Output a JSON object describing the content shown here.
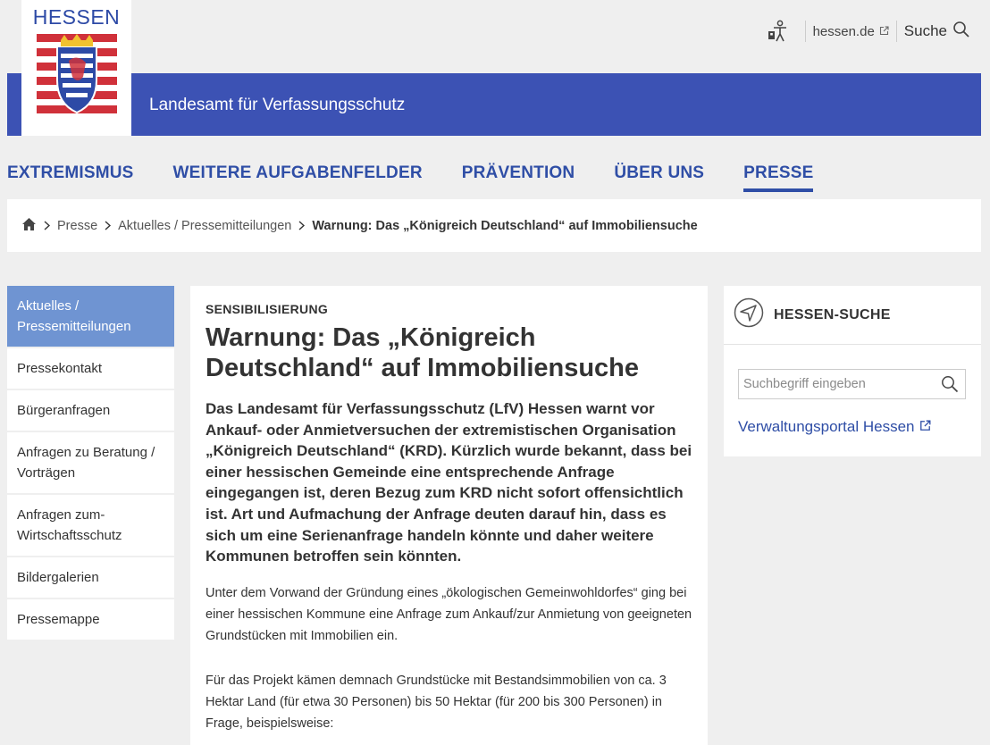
{
  "header": {
    "logo_text": "HESSEN",
    "portal_link": "hessen.de",
    "search_label": "Suche",
    "banner_title": "Landesamt für Verfassungsschutz"
  },
  "main_nav": [
    {
      "label": "EXTREMISMUS"
    },
    {
      "label": "WEITERE AUFGABENFELDER"
    },
    {
      "label": "PRÄVENTION"
    },
    {
      "label": "ÜBER UNS"
    },
    {
      "label": "PRESSE"
    }
  ],
  "breadcrumb": {
    "items": [
      "Presse",
      "Aktuelles / Pressemitteilungen"
    ],
    "current": "Warnung: Das „Königreich Deutschland“ auf Immobiliensuche"
  },
  "sidebar": {
    "items": [
      {
        "label": "Aktuelles / Pressemitteilungen"
      },
      {
        "label": "Pressekontakt"
      },
      {
        "label": "Bürgeranfragen"
      },
      {
        "label": "Anfragen zu Beratung / Vorträgen"
      },
      {
        "label": "Anfragen zum-Wirtschaftsschutz"
      },
      {
        "label": "Bildergalerien"
      },
      {
        "label": "Pressemappe"
      }
    ]
  },
  "article": {
    "kicker": "SENSIBILISIERUNG",
    "title": "Warnung: Das „Königreich Deutschland“ auf Immobiliensuche",
    "lead": "Das Landesamt für Verfassungsschutz (LfV) Hessen warnt vor Ankauf- oder Anmietversuchen der extremistischen Organisation „Königreich Deutschland“ (KRD). Kürzlich wurde bekannt, dass bei einer hessischen Gemeinde eine entsprechende Anfrage eingegangen ist, deren Bezug zum KRD nicht sofort offensichtlich ist. Art und Aufmachung der Anfrage deuten darauf hin, dass es sich um eine Serienanfrage handeln könnte und daher weitere Kommunen betroffen sein könnten.",
    "paragraph1": "Unter dem Vorwand der Gründung eines „ökologischen Gemeinwohldorfes“ ging bei einer hessischen Kommune eine Anfrage zum Ankauf/zur Anmietung von geeigneten Grundstücken mit Immobilien ein.",
    "paragraph2": "Für das Projekt kämen demnach Grundstücke mit Bestandsimmobilien von ca. 3 Hektar Land (für etwa 30 Personen) bis 50 Hektar (für 200 bis 300 Personen) in Frage, beispielsweise:"
  },
  "search_box": {
    "title": "HESSEN-SUCHE",
    "placeholder": "Suchbegriff eingeben",
    "portal_link": "Verwaltungsportal Hessen"
  },
  "colors": {
    "banner": "#3c52b4",
    "nav_text": "#2f4ea6",
    "sidebar_active": "#6f94d2",
    "coat_red": "#d0313a",
    "coat_blue": "#2d4aa6"
  }
}
